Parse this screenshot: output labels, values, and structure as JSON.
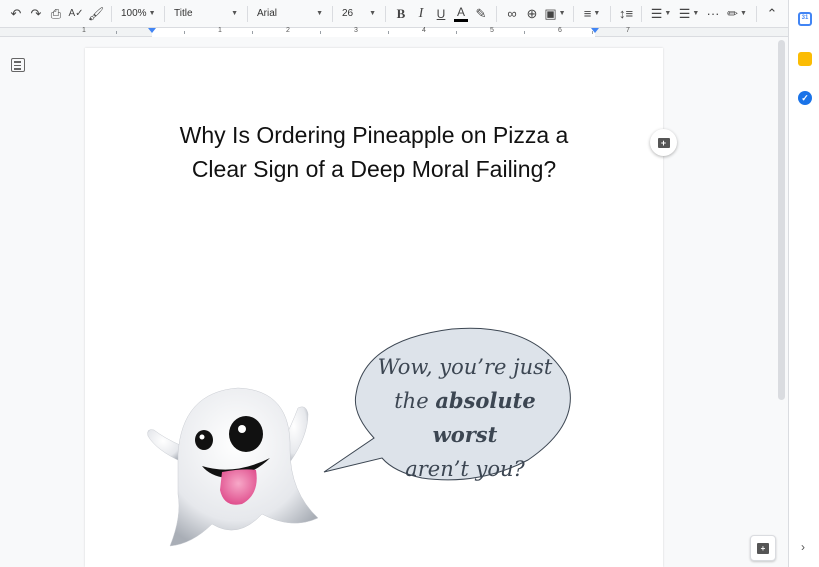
{
  "toolbar": {
    "zoom": "100%",
    "style": "Title",
    "font": "Arial",
    "font_size": "26",
    "bold": "B",
    "italic": "I",
    "underline": "U",
    "text_color": "A",
    "more": "···"
  },
  "ruler": {
    "numbers": [
      "1",
      "1",
      "2",
      "3",
      "4",
      "5",
      "6",
      "7"
    ]
  },
  "document": {
    "title_line1": "Why Is Ordering Pineapple on Pizza a",
    "title_line2": "Clear Sign of a Deep Moral Failing?"
  },
  "bubble": {
    "line1": "Wow, you’re just",
    "line2_pre": "the ",
    "line2_bold": "absolute worst",
    "line3": "aren’t you?"
  },
  "side_panel": {
    "calendar_label": "31",
    "tasks_label": "✓"
  },
  "icons": {
    "undo": "undo-icon",
    "redo": "redo-icon",
    "print": "print-icon",
    "spellcheck": "spellcheck-icon",
    "paint_format": "paint-format-icon",
    "highlight": "highlighter-icon",
    "link": "link-icon",
    "comment": "add-comment-icon",
    "image": "image-icon",
    "align": "align-left-icon",
    "line_spacing": "line-spacing-icon",
    "numbered_list": "numbered-list-icon",
    "bulleted_list": "bulleted-list-icon",
    "edit_mode": "pencil-icon",
    "collapse": "chevron-up-icon"
  },
  "colors": {
    "accent": "#4285f4",
    "bubble_fill": "#dde3ea",
    "bubble_text": "#3c4652"
  }
}
